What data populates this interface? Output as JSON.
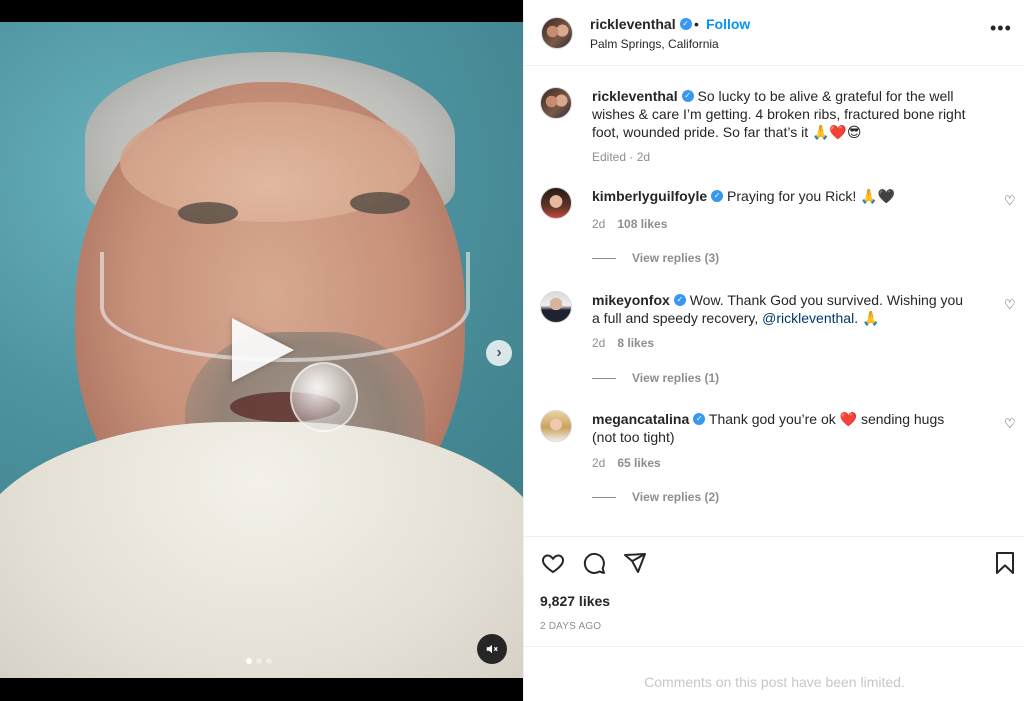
{
  "post": {
    "username": "rickleventhal",
    "verified_mark": "✓",
    "separator": "•",
    "follow_label": "Follow",
    "location": "Palm Springs, California",
    "more_label": "•••"
  },
  "caption": {
    "username": "rickleventhal",
    "text": " So lucky to be alive & grateful for the well wishes & care I’m getting. 4 broken ribs, fractured bone right foot, wounded pride. So far that’s it 🙏❤️😎",
    "edited": "Edited · 2d"
  },
  "comments": [
    {
      "username": "kimberlyguilfoyle",
      "text": " Praying for you Rick! 🙏🖤",
      "time": "2d",
      "likes": "108 likes",
      "replies": "View replies (3)"
    },
    {
      "username": "mikeyonfox",
      "text": " Wow. Thank God you survived. Wishing you a full and speedy recovery, ",
      "mention": "@rickleventhal",
      "text_after": ". 🙏",
      "time": "2d",
      "likes": "8 likes",
      "replies": "View replies (1)"
    },
    {
      "username": "megancatalina",
      "text": " Thank god you’re ok ❤️ sending hugs (not too tight)",
      "time": "2d",
      "likes": "65 likes",
      "replies": "View replies (2)"
    }
  ],
  "actions": {
    "likes": "9,827 likes",
    "date": "2 DAYS AGO"
  },
  "footer": {
    "limited": "Comments on this post have been limited."
  },
  "icons": {
    "heart": "heart-icon",
    "comment": "comment-icon",
    "share": "share-icon",
    "save": "bookmark-icon",
    "play": "play-icon",
    "next": "chevron-right-icon",
    "mute": "muted-speaker-icon"
  },
  "carousel": {
    "slides": 3,
    "active": 1
  },
  "colors": {
    "accent": "#0095f6",
    "verified": "#3897f0",
    "muted": "#8e8e8e"
  }
}
